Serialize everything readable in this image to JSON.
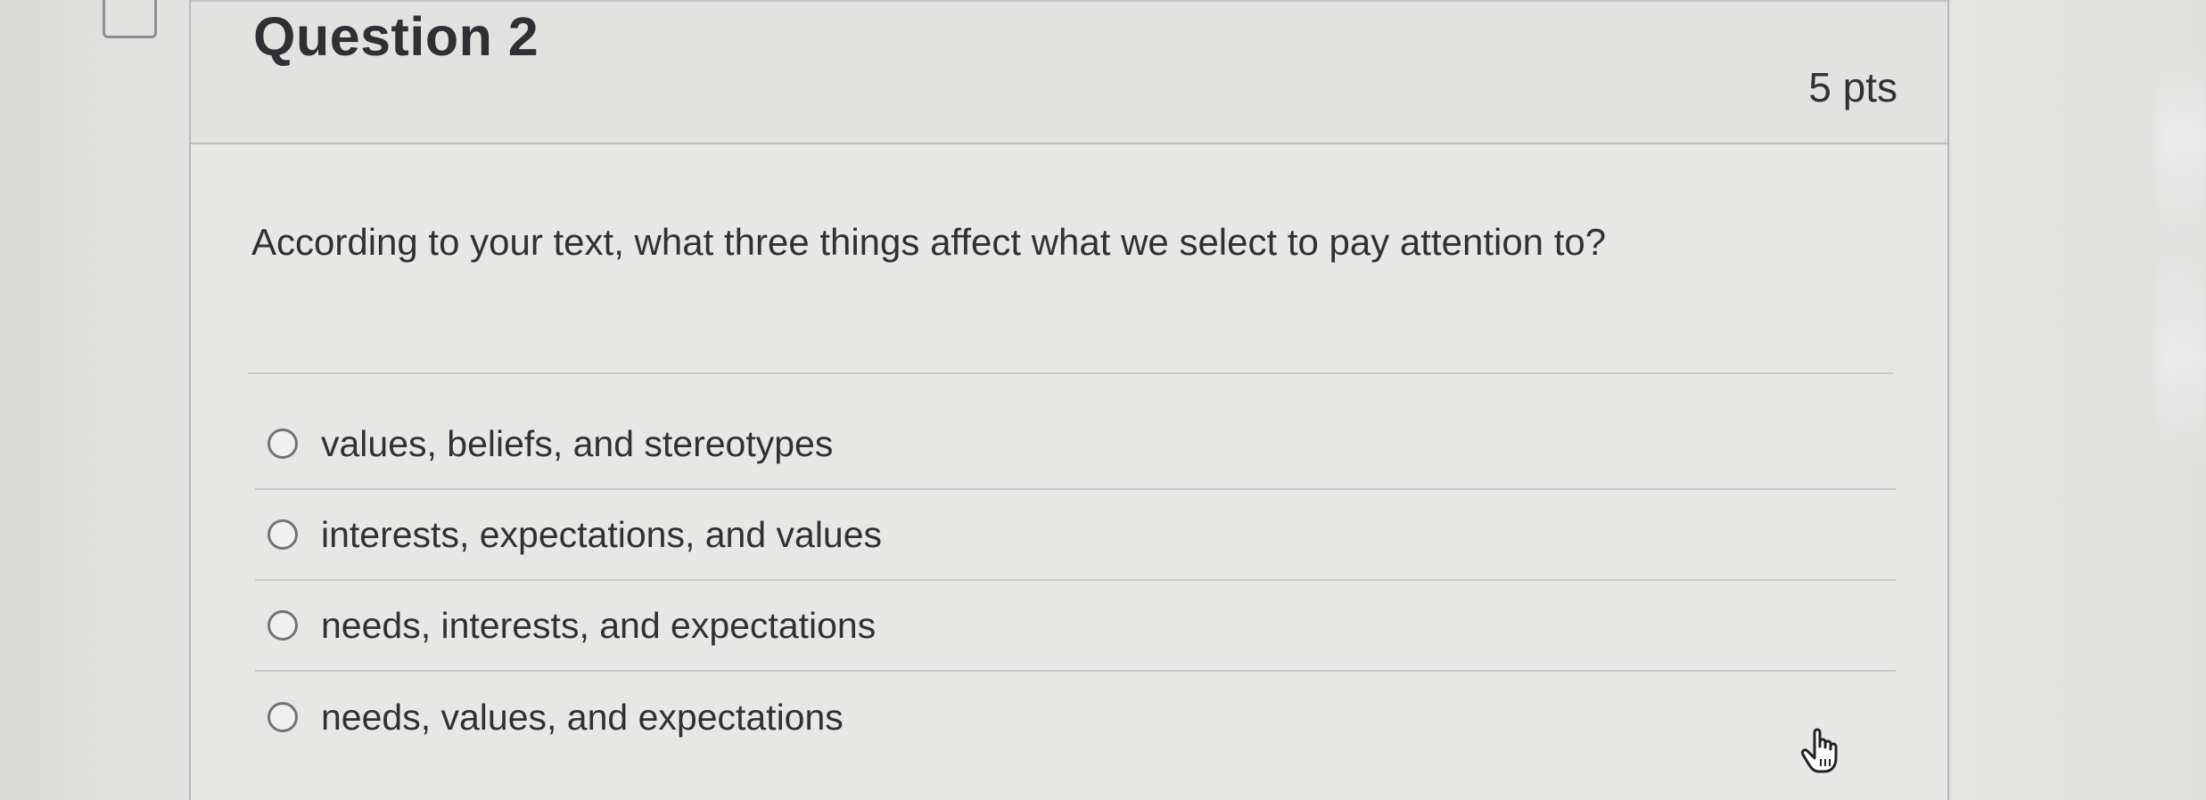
{
  "question": {
    "title": "Question 2",
    "points": "5 pts",
    "prompt": "According to your text, what three things affect what we select to pay attention to?"
  },
  "answers": [
    {
      "label": "values, beliefs, and stereotypes"
    },
    {
      "label": "interests, expectations, and values"
    },
    {
      "label": "needs, interests, and expectations"
    },
    {
      "label": "needs, values, and expectations"
    }
  ],
  "icons": {
    "previous_question_frame": "bookmark-frame-icon",
    "cursor": "hand-pointer-icon"
  },
  "colors": {
    "page_background": "#e4e5e3",
    "card_background": "#e7e7e5",
    "text": "#2f3135",
    "divider": "#c7c9c8"
  }
}
